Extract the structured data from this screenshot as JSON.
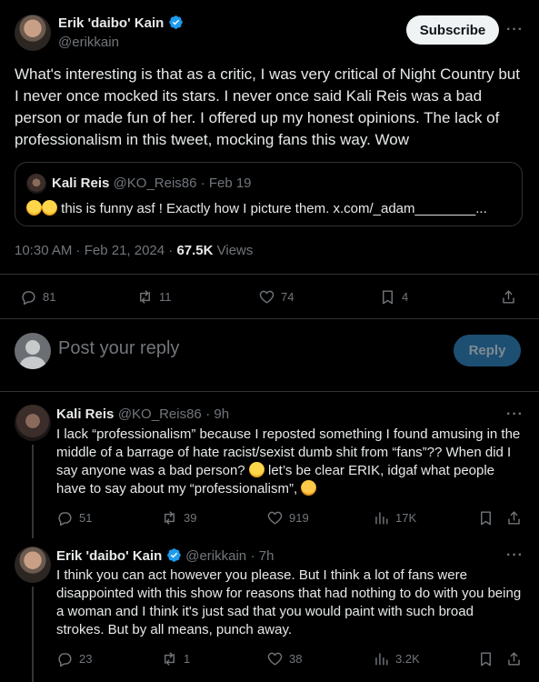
{
  "main_tweet": {
    "author_name": "Erik 'daibo' Kain",
    "author_handle": "@erikkain",
    "subscribe_label": "Subscribe",
    "text": "What's interesting is that as a critic, I was very critical of Night Country but I never once mocked its stars. I never once said Kali Reis was a bad person or made fun of her. I offered up my honest opinions. The lack of professionalism in this tweet, mocking fans this way. Wow",
    "quote": {
      "author_name": "Kali Reis",
      "author_handle": "@KO_Reis86",
      "date": "· Feb 19",
      "text": " this is funny asf ! Exactly how I picture them. x.com/_adam________..."
    },
    "time": "10:30 AM · Feb 21, 2024 · ",
    "views_count": "67.5K",
    "views_label": " Views",
    "actions": {
      "replies": "81",
      "reposts": "11",
      "likes": "74",
      "bookmarks": "4"
    }
  },
  "composer": {
    "placeholder": "Post your reply",
    "button_label": "Reply"
  },
  "replies": [
    {
      "author_name": "Kali Reis",
      "author_handle": "@KO_Reis86",
      "time": "· 9h",
      "text_a": "I lack “professionalism” because I reposted something I found amusing in the middle of a barrage of hate racist/sexist dumb shit from “fans”?? When did I say anyone was a bad person? ",
      "text_b": " let’s be clear ERIK, idgaf what people have to say about my “professionalism”, ",
      "replies": "51",
      "reposts": "39",
      "likes": "919",
      "views": "17K"
    },
    {
      "author_name": "Erik 'daibo' Kain",
      "author_handle": "@erikkain",
      "time": "· 7h",
      "text": "I think you can act however you please. But I think a lot of fans were disappointed with this show for reasons that had nothing to do with you being a woman and I think it's just sad that you would paint with such broad strokes.  But by all means, punch away.",
      "replies": "23",
      "reposts": "1",
      "likes": "38",
      "views": "3.2K"
    }
  ],
  "colors": {
    "verified": "#1d9bf0",
    "text": "#e7e9ea",
    "muted": "#71767b",
    "divider": "#2f3336"
  }
}
